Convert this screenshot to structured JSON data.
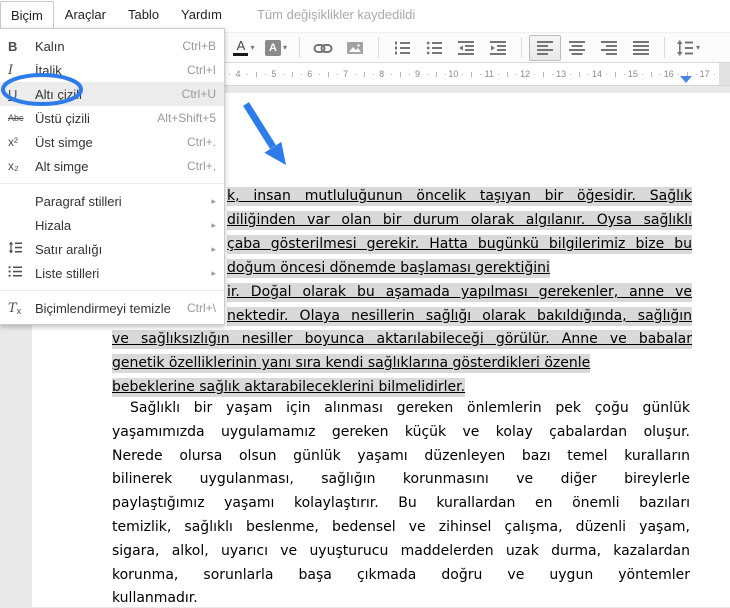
{
  "menubar": {
    "items": [
      {
        "label": "Biçim",
        "open": true
      },
      {
        "label": "Araçlar"
      },
      {
        "label": "Tablo"
      },
      {
        "label": "Yardım"
      }
    ],
    "status": "Tüm değişiklikler kaydedildi"
  },
  "toolbar": {
    "text_color_glyph": "A",
    "highlight_glyph": "A",
    "caret": "▾"
  },
  "ruler": {
    "numbers": [
      4,
      5,
      6,
      7,
      8,
      9,
      10,
      11,
      12,
      13,
      14,
      15,
      16,
      17
    ]
  },
  "format_menu": {
    "glyphs": {
      "bold": "B",
      "italic": "I",
      "underline": "U",
      "strikethrough": "Abc",
      "superscript": "x²",
      "subscript": "x₂",
      "clear_t": "T",
      "clear_x": "x",
      "submenu_arrow": "▸"
    },
    "items": [
      {
        "label": "Kalın",
        "shortcut": "Ctrl+B"
      },
      {
        "label": "İtalik",
        "shortcut": "Ctrl+I"
      },
      {
        "label": "Altı çizili",
        "shortcut": "Ctrl+U",
        "highlighted": true
      },
      {
        "label": "Üstü çizili",
        "shortcut": "Alt+Shift+5"
      },
      {
        "label": "Üst simge",
        "shortcut": "Ctrl+."
      },
      {
        "label": "Alt simge",
        "shortcut": "Ctrl+,"
      },
      {
        "label": "Paragraf stilleri",
        "submenu": true
      },
      {
        "label": "Hizala",
        "submenu": true
      },
      {
        "label": "Satır aralığı",
        "submenu": true
      },
      {
        "label": "Liste stilleri",
        "submenu": true
      },
      {
        "label": "Biçimlendirmeyi temizle",
        "shortcut": "Ctrl+\\"
      }
    ]
  },
  "document": {
    "selected_lines": [
      {
        "text": "k, insan mutluluğunun öncelik taşıyan bir öğesidir. Sağlık",
        "occluded": true,
        "flush": true
      },
      {
        "text": "diliğinden var olan bir durum olarak algılanır. Oysa sağlıklı",
        "occluded": true,
        "flush": true
      },
      {
        "text": "çaba gösterilmesi gerekir. Hatta bugünkü bilgilerimiz bize bu",
        "occluded": true,
        "flush": true
      },
      {
        "text": "doğum öncesi dönemde başlaması gerektiğini",
        "occluded": true,
        "flush": false
      },
      {
        "text": "ir. Doğal olarak bu aşamada yapılması gerekenler, anne ve",
        "occluded": true,
        "flush": true
      },
      {
        "text": "nektedir. Olaya nesillerin sağlığı olarak bakıldığında, sağlığın",
        "occluded": true,
        "flush": true
      },
      {
        "text": "ve sağlıksızlığın nesiller boyunca aktarılabileceği görülür. Anne ve babalar",
        "occluded": false,
        "flush": true
      },
      {
        "text": "genetik özelliklerinin yanı sıra kendi sağlıklarına gösterdikleri özenle",
        "occluded": false,
        "flush": false
      },
      {
        "text": "bebeklerine sağlık aktarabileceklerini bilmelidirler.",
        "occluded": false,
        "flush": false
      }
    ],
    "paragraph_lines": [
      {
        "text": "Sağlıklı bir yaşam için alınması gereken önlemlerin pek çoğu günlük",
        "indent": true,
        "flush": true
      },
      {
        "text": "yaşamımızda uygulamamız gereken küçük ve kolay çabalardan oluşur.",
        "flush": true
      },
      {
        "text": "Nerede olursa olsun günlük yaşamı düzenleyen bazı temel kuralların",
        "flush": true
      },
      {
        "text": "bilinerek uygulanması, sağlığın korunmasını ve diğer bireylerle",
        "flush": true
      },
      {
        "text": "paylaştığımız yaşamı kolaylaştırır. Bu kurallardan en önemli bazıları",
        "flush": true
      },
      {
        "text": "temizlik, sağlıklı beslenme, bedensel ve zihinsel çalışma, düzenli yaşam,",
        "flush": true
      },
      {
        "text": "sigara, alkol, uyarıcı ve uyuşturucu maddelerden uzak durma, kazalardan",
        "flush": true
      },
      {
        "text": "korunma, sorunlarla başa çıkmada doğru ve uygun yöntemler",
        "flush": true
      },
      {
        "text": "kullanmadır.",
        "flush": false
      }
    ]
  },
  "annotations": {
    "color": "#2e7cea"
  }
}
